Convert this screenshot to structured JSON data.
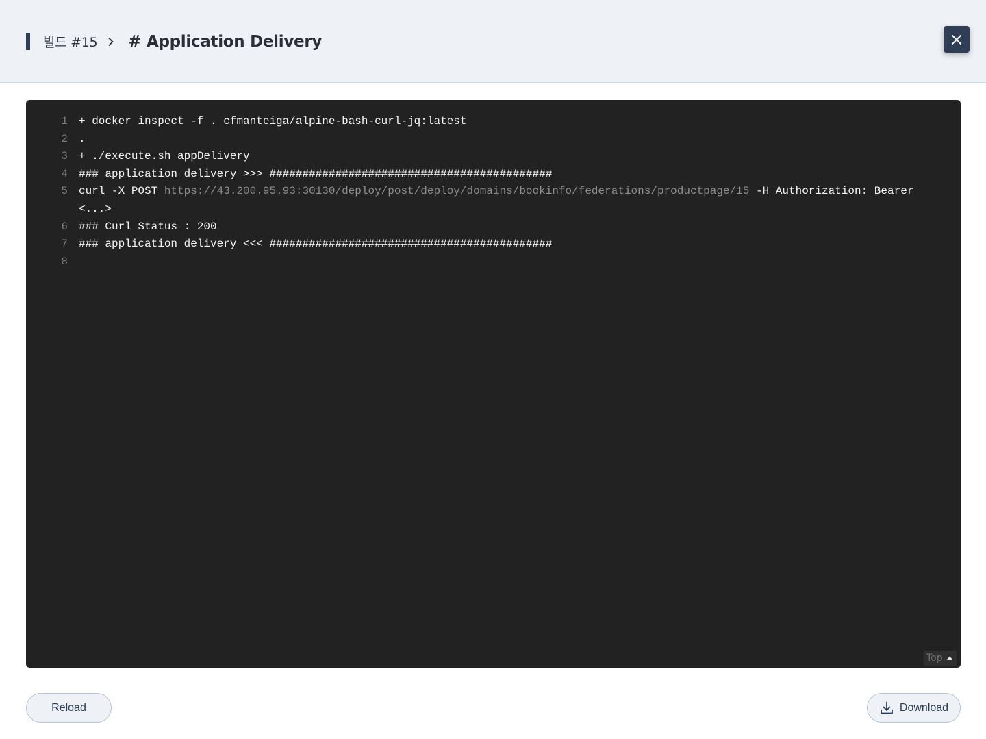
{
  "header": {
    "breadcrumb_parent": "빌드 #15",
    "title": "# Application Delivery",
    "close_icon": "close-icon"
  },
  "console": {
    "lines": [
      {
        "num": "1",
        "text": "+ docker inspect -f . cfmanteiga/alpine-bash-curl-jq:latest"
      },
      {
        "num": "2",
        "text": "."
      },
      {
        "num": "3",
        "text": "+ ./execute.sh appDelivery"
      },
      {
        "num": "4",
        "text": "### application delivery >>> ###########################################"
      },
      {
        "num": "5",
        "prefix": "curl -X POST ",
        "url": "https://43.200.95.93:30130/deploy/post/deploy/domains/bookinfo/federations/productpage/15",
        "suffix": " -H Authorization: Bearer <...>"
      },
      {
        "num": "6",
        "text": "### Curl Status : 200"
      },
      {
        "num": "7",
        "text": "### application delivery <<< ###########################################"
      },
      {
        "num": "8",
        "text": ""
      }
    ],
    "top_label": "Top"
  },
  "footer": {
    "reload_label": "Reload",
    "download_label": "Download"
  },
  "colors": {
    "header_bg": "#eef2f7",
    "accent": "#2f3d55",
    "console_bg": "#222222",
    "console_text": "#f2f2f2",
    "url_text": "#8c8c8c"
  }
}
